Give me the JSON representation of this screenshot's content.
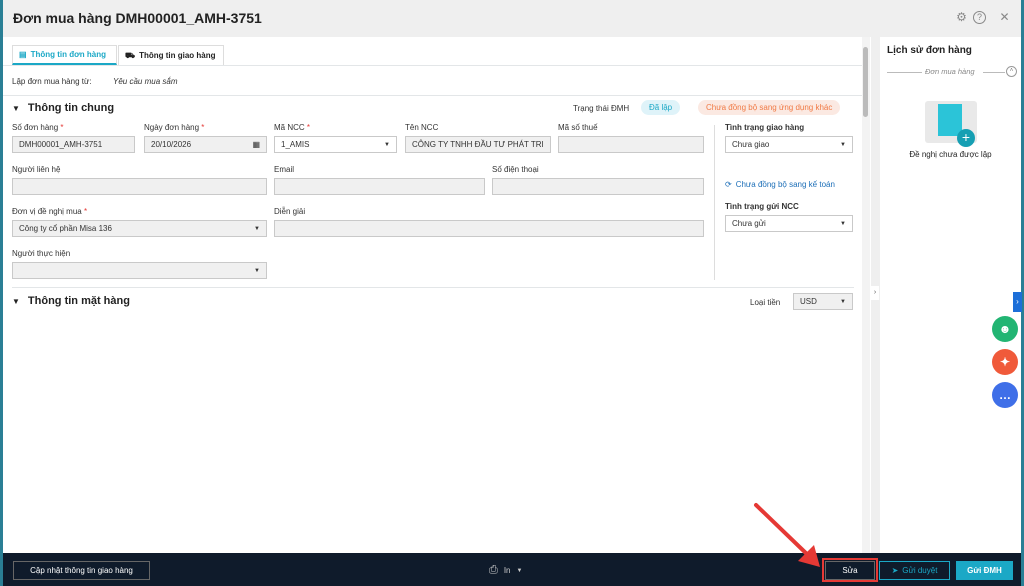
{
  "title": "Đơn mua hàng DMH00001_AMH-3751",
  "tabs": [
    {
      "label": "Thông tin đơn hàng"
    },
    {
      "label": "Thông tin giao hàng"
    }
  ],
  "source": {
    "label": "Lập đơn mua hàng từ:",
    "value": "Yêu cầu mua sắm"
  },
  "general": {
    "title": "Thông tin chung",
    "status_label": "Trạng thái ĐMH",
    "status": "Đã lập",
    "sync": "Chưa đồng bộ sang ứng dụng khác"
  },
  "fields": {
    "order_no": {
      "label": "Số đơn hàng",
      "value": "DMH00001_AMH-3751"
    },
    "order_date": {
      "label": "Ngày đơn hàng",
      "value": "20/10/2026"
    },
    "supplier_code": {
      "label": "Mã NCC",
      "value": "1_AMIS"
    },
    "supplier_name": {
      "label": "Tên NCC",
      "value": "CÔNG TY TNHH ĐẦU TƯ PHÁT TRI"
    },
    "tax_code": {
      "label": "Mã số thuế",
      "value": ""
    },
    "contact": {
      "label": "Người liên hệ",
      "value": ""
    },
    "email": {
      "label": "Email",
      "value": ""
    },
    "phone": {
      "label": "Số điện thoại",
      "value": ""
    },
    "unit": {
      "label": "Đơn vị đề nghị mua",
      "value": "Công ty cổ phần Misa 136"
    },
    "description": {
      "label": "Diễn giải",
      "value": ""
    },
    "executor": {
      "label": "Người thực hiện",
      "value": ""
    },
    "delivery_status": {
      "label": "Tình trạng giao hàng",
      "value": "Chưa giao"
    },
    "accounting_sync": "Chưa đồng bộ sang kế toán",
    "send_status": {
      "label": "Tình trạng gửi NCC",
      "value": "Chưa gửi"
    }
  },
  "items": {
    "title": "Thông tin mặt hàng",
    "currency_label": "Loại tiền",
    "currency": "USD"
  },
  "history": {
    "title": "Lịch sử đơn hàng",
    "section": "Đơn mua hàng",
    "empty": "Đề nghị chưa được lập"
  },
  "footer": {
    "update_delivery": "Cập nhật thông tin giao hàng",
    "print": "In",
    "edit": "Sửa",
    "send_approval": "Gửi duyệt",
    "send_order": "Gửi ĐMH"
  }
}
